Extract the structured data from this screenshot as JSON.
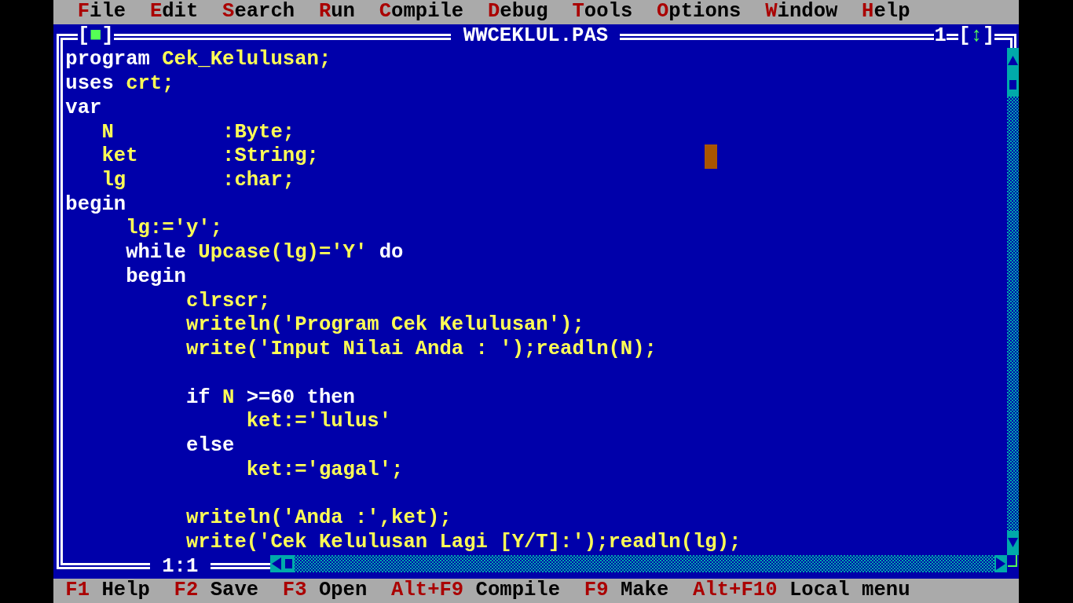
{
  "menu": [
    {
      "label": "File"
    },
    {
      "label": "Edit"
    },
    {
      "label": "Search"
    },
    {
      "label": "Run"
    },
    {
      "label": "Compile"
    },
    {
      "label": "Debug"
    },
    {
      "label": "Tools"
    },
    {
      "label": "Options"
    },
    {
      "label": "Window"
    },
    {
      "label": "Help"
    }
  ],
  "editor": {
    "close_box": {
      "open": "[",
      "glyph": "■",
      "close": "]"
    },
    "title": "WWCEKLUL.PAS",
    "window_number": "1",
    "zoom_box": {
      "open": "[",
      "glyph": "↕",
      "close": "]"
    },
    "position": "1:1",
    "lines": [
      {
        "kind": "code",
        "tokens": [
          {
            "kind": "keyword",
            "text": "program"
          },
          {
            "kind": "plain",
            "text": " Cek_Kelulusan;"
          }
        ]
      },
      {
        "kind": "code",
        "tokens": [
          {
            "kind": "keyword",
            "text": "uses"
          },
          {
            "kind": "plain",
            "text": " crt;"
          }
        ]
      },
      {
        "kind": "code",
        "tokens": [
          {
            "kind": "keyword",
            "text": "var"
          }
        ]
      },
      {
        "kind": "code",
        "tokens": [
          {
            "kind": "plain",
            "text": "   N         :Byte;"
          }
        ]
      },
      {
        "kind": "code",
        "tokens": [
          {
            "kind": "plain",
            "text": "   ket       :String;"
          }
        ]
      },
      {
        "kind": "code",
        "tokens": [
          {
            "kind": "plain",
            "text": "   lg        :char;"
          }
        ]
      },
      {
        "kind": "code",
        "tokens": [
          {
            "kind": "keyword",
            "text": "begin"
          }
        ]
      },
      {
        "kind": "code",
        "tokens": [
          {
            "kind": "plain",
            "text": "     lg:='y';"
          }
        ]
      },
      {
        "kind": "code",
        "tokens": [
          {
            "kind": "keyword",
            "text": "     while"
          },
          {
            "kind": "plain",
            "text": " Upcase(lg)='Y'"
          },
          {
            "kind": "keyword",
            "text": " do"
          }
        ]
      },
      {
        "kind": "code",
        "tokens": [
          {
            "kind": "keyword",
            "text": "     begin"
          }
        ]
      },
      {
        "kind": "code",
        "tokens": [
          {
            "kind": "plain",
            "text": "          clrscr;"
          }
        ]
      },
      {
        "kind": "code",
        "tokens": [
          {
            "kind": "plain",
            "text": "          writeln('Program Cek Kelulusan');"
          }
        ]
      },
      {
        "kind": "code",
        "tokens": [
          {
            "kind": "plain",
            "text": "          write('Input Nilai Anda : ');readln(N);"
          }
        ]
      },
      {
        "kind": "blank"
      },
      {
        "kind": "code",
        "tokens": [
          {
            "kind": "keyword",
            "text": "          if"
          },
          {
            "kind": "plain",
            "text": " N"
          },
          {
            "kind": "symbol",
            "text": " >=60"
          },
          {
            "kind": "keyword",
            "text": " then"
          }
        ]
      },
      {
        "kind": "code",
        "tokens": [
          {
            "kind": "plain",
            "text": "               ket:='lulus'"
          }
        ]
      },
      {
        "kind": "code",
        "tokens": [
          {
            "kind": "keyword",
            "text": "          else"
          }
        ]
      },
      {
        "kind": "code",
        "tokens": [
          {
            "kind": "plain",
            "text": "               ket:='gagal';"
          }
        ]
      },
      {
        "kind": "blank"
      },
      {
        "kind": "code",
        "tokens": [
          {
            "kind": "plain",
            "text": "          writeln('Anda :',ket);"
          }
        ]
      },
      {
        "kind": "code",
        "tokens": [
          {
            "kind": "plain",
            "text": "          write('Cek Kelulusan Lagi [Y/T]:');readln(lg);"
          }
        ]
      }
    ]
  },
  "status_bar": [
    {
      "key": "F1",
      "label": "Help"
    },
    {
      "key": "F2",
      "label": "Save"
    },
    {
      "key": "F3",
      "label": "Open"
    },
    {
      "key": "Alt+F9",
      "label": "Compile"
    },
    {
      "key": "F9",
      "label": "Make"
    },
    {
      "key": "Alt+F10",
      "label": "Local menu"
    }
  ]
}
